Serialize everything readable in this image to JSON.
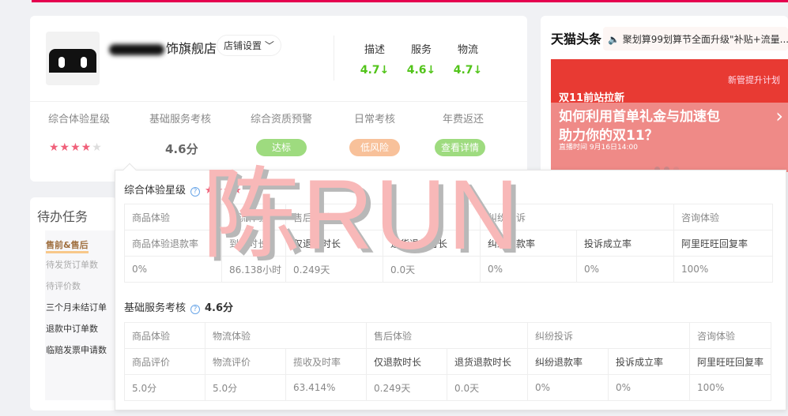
{
  "shop": {
    "name_suffix": "饰旗舰店",
    "settings_label": "店铺设置 ﹀"
  },
  "dsr": [
    {
      "label": "描述",
      "value": "4.7↓"
    },
    {
      "label": "服务",
      "value": "4.6↓"
    },
    {
      "label": "物流",
      "value": "4.7↓"
    }
  ],
  "metrics": {
    "titles": [
      "综合体验星级",
      "基础服务考核",
      "综合资质预警",
      "日常考核",
      "年费返还"
    ],
    "stars": 4,
    "stars_max": 5,
    "stars_on": "★★★★",
    "stars_off": "★",
    "basic_score": "4.6分",
    "qualification": "达标",
    "daily": "低风险",
    "annual": "查看详情"
  },
  "colors": {
    "green": "#52c41a",
    "pill_green": "#9edb7f",
    "pill_orange": "#f8c19a",
    "star": "#f0607a",
    "brand": "#e5004f"
  },
  "headline": {
    "logo": "天猫头条",
    "news": "聚划算99划算节全面升级\"补贴+流量..."
  },
  "banner": {
    "tag": "双11前站拉新",
    "title1": "如何利用首单礼金与加速包",
    "title2": "助力你的双11？",
    "time": "直播时间 9月16日14:00",
    "brand": "新管提升计划"
  },
  "todo": {
    "title": "待办任务",
    "tab": "售前&售后",
    "items": [
      "待发货订单数",
      "待评价数",
      "三个月未结订单",
      "退款中订单数",
      "临赔发票申请数"
    ]
  },
  "popover": {
    "s1": {
      "title": "综合体验星级",
      "stars": "★★★★",
      "groups": [
        "商品体验",
        "物流体验",
        "售后体验",
        "纠纷投诉",
        "咨询体验"
      ],
      "headers": [
        "商品体验退款率",
        "到货时长",
        "仅退款时长",
        "退货退款时长",
        "纠纷退款率",
        "投诉成立率",
        "阿里旺旺回复率"
      ],
      "values": [
        "0%",
        "86.138小时",
        "0.249天",
        "0.0天",
        "0%",
        "0%",
        "100%"
      ]
    },
    "s2": {
      "title": "基础服务考核",
      "score": "4.6分",
      "groups": [
        "商品体验",
        "物流体验",
        "售后体验",
        "纠纷投诉",
        "咨询体验"
      ],
      "headers": [
        "商品评价",
        "物流评价",
        "揽收及时率",
        "仅退款时长",
        "退货退款时长",
        "纠纷退款率",
        "投诉成立率",
        "阿里旺旺回复率"
      ],
      "values": [
        "5.0分",
        "5.0分",
        "63.414%",
        "0.249天",
        "0.0天",
        "0%",
        "0%",
        "100%"
      ]
    }
  },
  "watermark": "陈RUN"
}
